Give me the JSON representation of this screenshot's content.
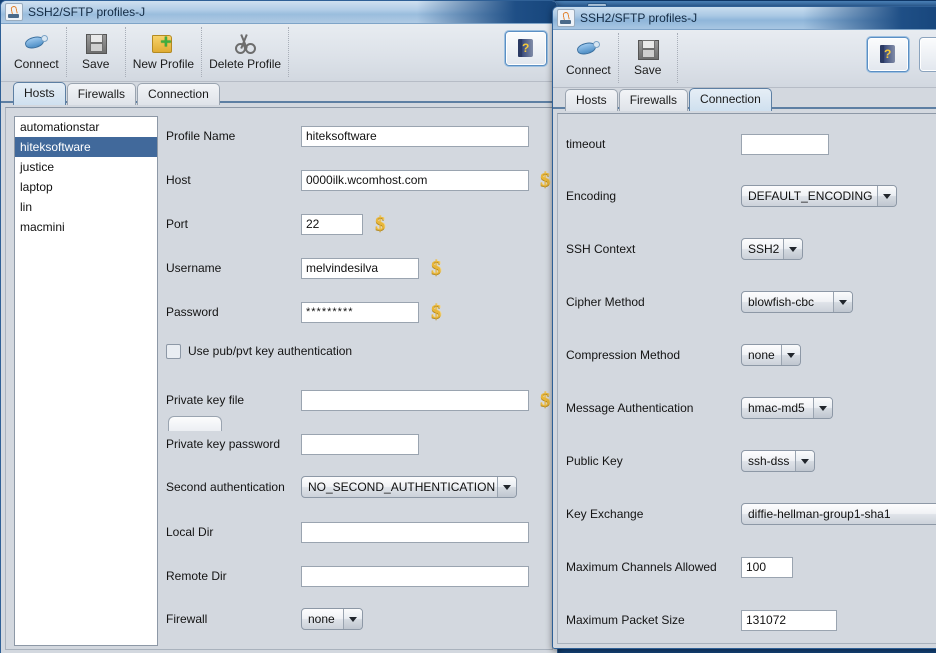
{
  "left_window": {
    "title": "SSH2/SFTP profiles-J",
    "app_icon": "java-coffee-icon",
    "toolbar": [
      {
        "label": "Connect",
        "icon": "plug-icon"
      },
      {
        "label": "Save",
        "icon": "floppy-disk-icon"
      },
      {
        "label": "New Profile",
        "icon": "folder-add-icon"
      },
      {
        "label": "Delete Profile",
        "icon": "scissors-icon"
      }
    ],
    "help_button": {
      "icon": "help-book-icon",
      "label": "?"
    },
    "tabs": [
      {
        "label": "Hosts",
        "active": true
      },
      {
        "label": "Firewalls",
        "active": false
      },
      {
        "label": "Connection",
        "active": false
      }
    ],
    "profiles": [
      {
        "label": "automationstar",
        "selected": false
      },
      {
        "label": "hiteksoftware",
        "selected": true
      },
      {
        "label": "justice",
        "selected": false
      },
      {
        "label": "laptop",
        "selected": false
      },
      {
        "label": "lin",
        "selected": false
      },
      {
        "label": "macmini",
        "selected": false
      }
    ],
    "fields": {
      "profile_name": {
        "label": "Profile Name",
        "value": "hiteksoftware"
      },
      "host": {
        "label": "Host",
        "value": "0000ilk.wcomhost.com",
        "badge": "$"
      },
      "port": {
        "label": "Port",
        "value": "22",
        "badge": "$"
      },
      "username": {
        "label": "Username",
        "value": "melvindesilva",
        "badge": "$"
      },
      "password": {
        "label": "Password",
        "value": "*********",
        "badge": "$"
      },
      "use_pubkey": {
        "label": "Use pub/pvt key authentication",
        "checked": false
      },
      "private_key_file": {
        "label": "Private key file",
        "value": "",
        "badge": "$"
      },
      "private_key_password": {
        "label": "Private key password",
        "value": ""
      },
      "second_authentication": {
        "label": "Second authentication",
        "value": "NO_SECOND_AUTHENTICATION"
      },
      "local_dir": {
        "label": "Local Dir",
        "value": ""
      },
      "remote_dir": {
        "label": "Remote Dir",
        "value": ""
      },
      "firewall": {
        "label": "Firewall",
        "value": "none"
      }
    }
  },
  "right_window": {
    "title": "SSH2/SFTP profiles-J",
    "app_icon": "java-coffee-icon",
    "toolbar": [
      {
        "label": "Connect",
        "icon": "plug-icon"
      },
      {
        "label": "Save",
        "icon": "floppy-disk-icon"
      }
    ],
    "help_button": {
      "icon": "help-book-icon",
      "label": "?"
    },
    "tabs": [
      {
        "label": "Hosts",
        "active": false
      },
      {
        "label": "Firewalls",
        "active": false
      },
      {
        "label": "Connection",
        "active": true
      }
    ],
    "fields": {
      "timeout": {
        "label": "timeout",
        "value": ""
      },
      "encoding": {
        "label": "Encoding",
        "value": "DEFAULT_ENCODING"
      },
      "ssh_context": {
        "label": "SSH Context",
        "value": "SSH2"
      },
      "cipher_method": {
        "label": "Cipher Method",
        "value": "blowfish-cbc"
      },
      "compression_method": {
        "label": "Compression Method",
        "value": "none"
      },
      "message_authentication": {
        "label": "Message Authentication",
        "value": "hmac-md5"
      },
      "public_key": {
        "label": "Public Key",
        "value": "ssh-dss"
      },
      "key_exchange": {
        "label": "Key Exchange",
        "value": "diffie-hellman-group1-sha1"
      },
      "maximum_channels_allowed": {
        "label": "Maximum Channels Allowed",
        "value": "100"
      },
      "maximum_packet_size": {
        "label": "Maximum Packet Size",
        "value": "131072"
      }
    }
  },
  "colors": {
    "selection_blue": "#41699b",
    "panel_gray": "#d3d8df",
    "badge_gold": "#e8b63a",
    "desktop_blue": "#14457e"
  }
}
